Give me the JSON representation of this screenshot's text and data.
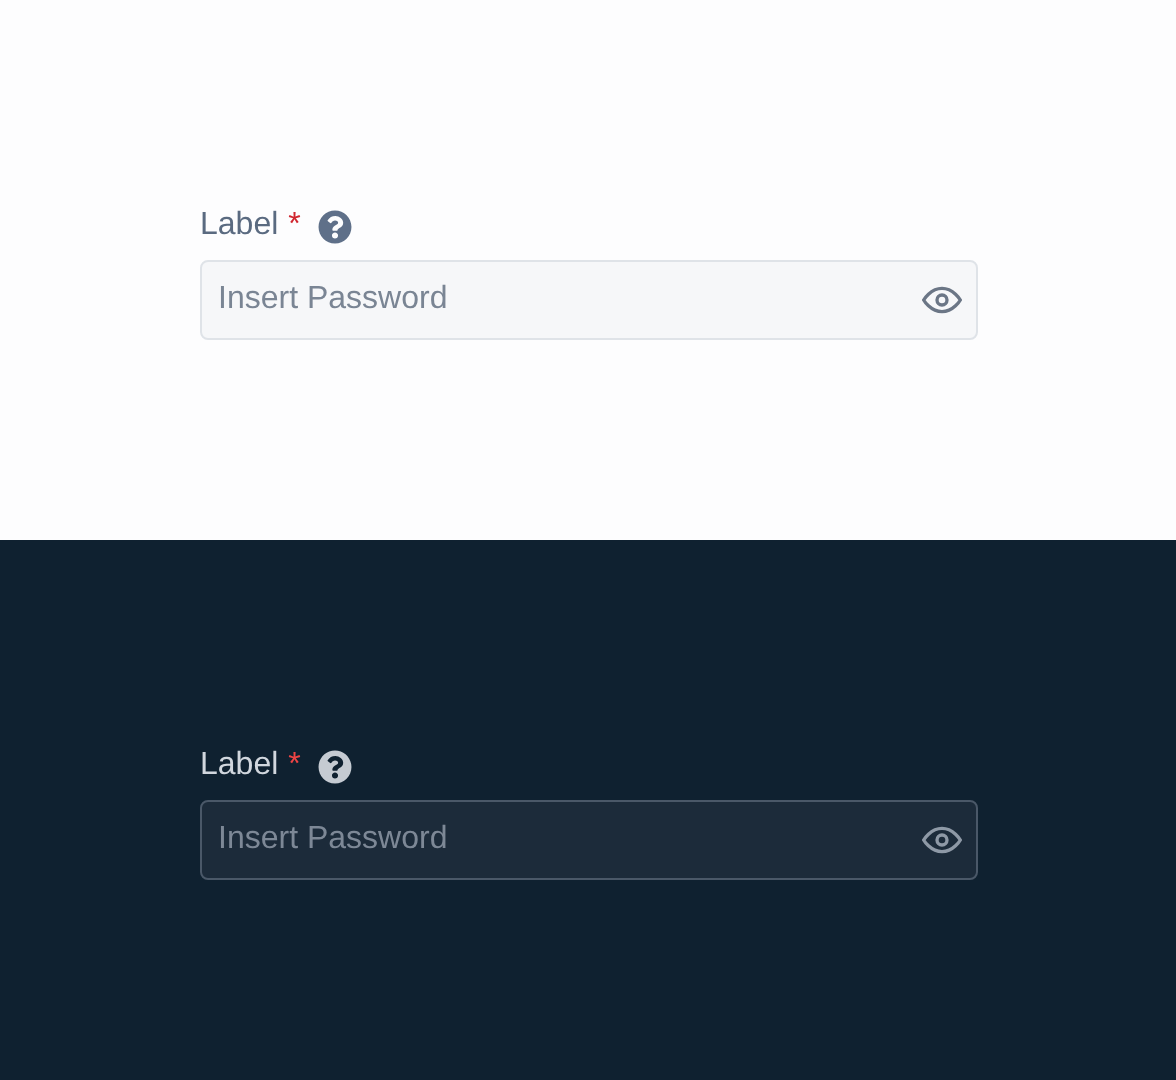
{
  "panels": [
    {
      "kind": "light",
      "label": "Label",
      "required_mark": "*",
      "placeholder": "Insert Password"
    },
    {
      "kind": "dark",
      "label": "Label",
      "required_mark": "*",
      "placeholder": "Insert Password"
    }
  ]
}
